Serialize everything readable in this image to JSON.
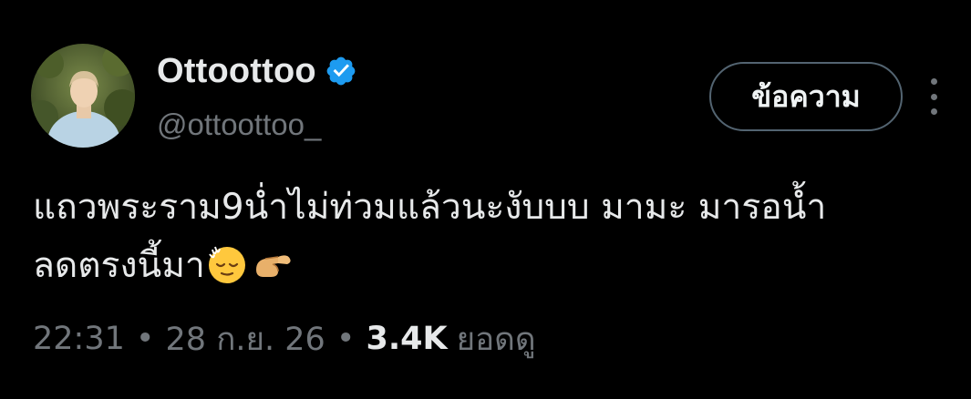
{
  "author": {
    "display_name": "Ottoottoo",
    "handle": "@ottoottoo_",
    "verified": true,
    "verified_icon": "verified-badge-icon",
    "avatar": "avatar"
  },
  "actions": {
    "message_label": "ข้อความ",
    "more_icon": "more-options-icon"
  },
  "tweet": {
    "line1": "แถวพระราม9น่ำไม่ท่วมแล้วนะงับบบ มามะ มารอน้ำ",
    "line2": "ลดตรงนี้มา",
    "emojis": [
      "relieved-face-sweat-icon",
      "pinching-hand-icon"
    ]
  },
  "meta": {
    "time": "22:31",
    "separator": "•",
    "date": "28 ก.ย. 26",
    "views_count": "3.4K",
    "views_label": "ยอดดู"
  },
  "colors": {
    "background": "#000000",
    "primary_text": "#e7e9ea",
    "secondary_text": "#71767b",
    "verified_blue": "#1d9bf0",
    "button_border": "#536471"
  }
}
